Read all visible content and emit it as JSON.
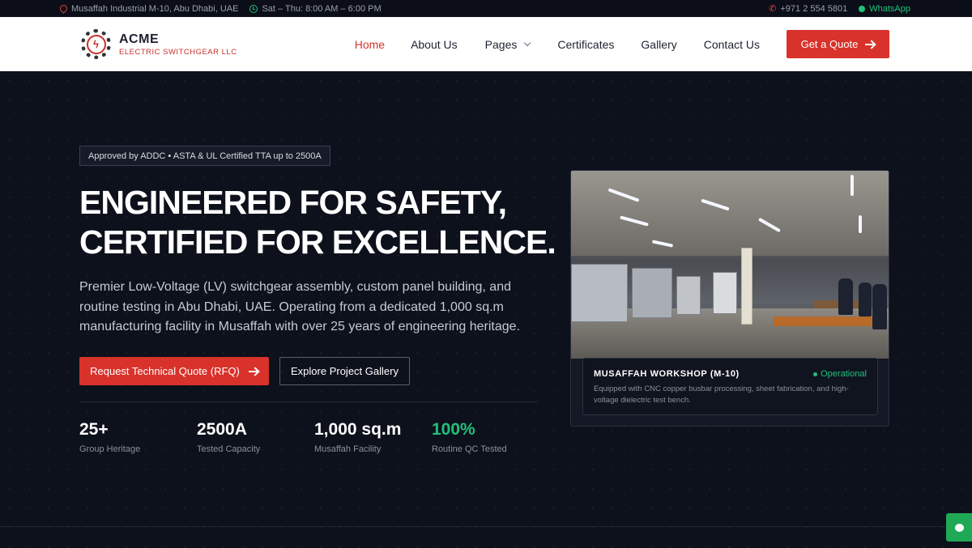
{
  "topbar": {
    "address": "Musaffah Industrial M-10, Abu Dhabi, UAE",
    "hours": "Sat – Thu: 8:00 AM – 6:00 PM",
    "phone": "+971 2 554 5801",
    "whatsapp": "WhatsApp"
  },
  "brand": {
    "name": "ACME",
    "tagline": "ELECTRIC SWITCHGEAR LLC",
    "accent": "#d8322b",
    "green": "#21c07a"
  },
  "nav": {
    "items": [
      "Home",
      "About Us",
      "Pages",
      "Certificates",
      "Gallery",
      "Contact Us"
    ],
    "active": "Home",
    "cta": "Get a Quote"
  },
  "hero": {
    "badge": "Approved by ADDC • ASTA & UL Certified TTA up to 2500A",
    "title_line1": "ENGINEERED FOR SAFETY,",
    "title_line2": "CERTIFIED FOR EXCELLENCE.",
    "description": "Premier Low-Voltage (LV) switchgear assembly, custom panel building, and routine testing in Abu Dhabi, UAE. Operating from a dedicated 1,000 sq.m manufacturing facility in Musaffah with over 25 years of engineering heritage.",
    "primary_button": "Request Technical Quote (RFQ)",
    "secondary_button": "Explore Project Gallery",
    "stats": [
      {
        "value": "25+",
        "label": "Group Heritage"
      },
      {
        "value": "2500A",
        "label": "Tested Capacity"
      },
      {
        "value": "1,000 sq.m",
        "label": "Musaffah Facility"
      },
      {
        "value": "100%",
        "label": "Routine QC Tested"
      }
    ]
  },
  "workshop": {
    "title": "MUSAFFAH WORKSHOP (M-10)",
    "status": "Operational",
    "description": "Equipped with CNC copper busbar processing, sheet fabrication, and high-voltage dielectric test bench."
  }
}
